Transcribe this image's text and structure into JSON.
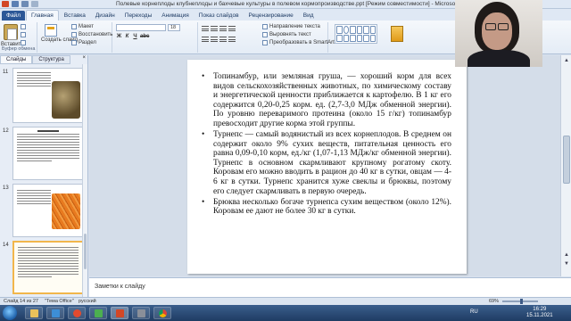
{
  "window": {
    "title": "Полевые корнеплоды клубнеплоды и бахчевые культуры в полевом кормопроизводстве.ppt [Режим совместимости] - Microsoft PowerPoint"
  },
  "ribbon": {
    "tabs": [
      "Файл",
      "Главная",
      "Вставка",
      "Дизайн",
      "Переходы",
      "Анимация",
      "Показ слайдов",
      "Рецензирование",
      "Вид"
    ],
    "active_tab": "Главная",
    "paste_label": "Вставить",
    "new_slide_label": "Создать слайд",
    "layout_label": "Макет",
    "reset_label": "Восстановить",
    "section_label": "Раздел",
    "text_direction_label": "Направление текста",
    "align_text_label": "Выровнять текст",
    "smartart_label": "Преобразовать в SmartArt",
    "quick_styles_label": "Экспресс-стили",
    "group_clipboard": "Буфер обмена",
    "group_slides": "Слайды",
    "group_font": "Шрифт",
    "group_paragraph": "Абзац",
    "group_drawing": "Рисование",
    "group_editing": "Редактирование",
    "font_size": "18"
  },
  "left_pane": {
    "tab_slides": "Слайды",
    "tab_outline": "Структура",
    "close": "×",
    "thumbnails": [
      {
        "number": "11",
        "selected": false
      },
      {
        "number": "12",
        "selected": false
      },
      {
        "number": "13",
        "selected": false
      },
      {
        "number": "14",
        "selected": true
      }
    ]
  },
  "slide": {
    "bullets": [
      "Топинамбур, или земляная груша, — хороший корм для всех видов сельскохозяйственных животных, по химическому составу и энергетической ценности приближается к картофелю. В 1 кг его содержится 0,20-0,25 корм. ед. (2,7-3,0 МДж обменной энергии). По уровню переваримого протеина (около 15 г/кг) топинамбур превосходит другие корма этой группы.",
      "Турнепс — самый водянистый из всех корнеплодов. В среднем он содержит около 9% сухих веществ, питательная ценность его равна 0,09-0,10 корм, ед./кг (1,07-1,13 МДж/кг обменной энергии). Турнепс в основном скармливают крупному рогатому скоту. Коровам его можно вводить в рацион до 40 кг в сутки, овцам — 4-6 кг в сутки. Турнепс хранится хуже свеклы и брюквы, поэтому его следует скармливать в первую очередь.",
      "Брюква несколько богаче турнепса сухим веществом (около 12%). Коровам ее дают не более 30 кг в сутки."
    ]
  },
  "notes": {
    "placeholder": "Заметки к слайду"
  },
  "status": {
    "slide_info": "Слайд 14 из 27",
    "theme": "\"Тема Office\"",
    "language": "русский",
    "zoom": "69%"
  },
  "taskbar": {
    "language": "RU",
    "time": "16:29",
    "date": "15.11.2021"
  },
  "colors": {
    "file_tab": "#2b5797",
    "selection": "#f1b64b",
    "taskbar": "#1f3c63"
  }
}
